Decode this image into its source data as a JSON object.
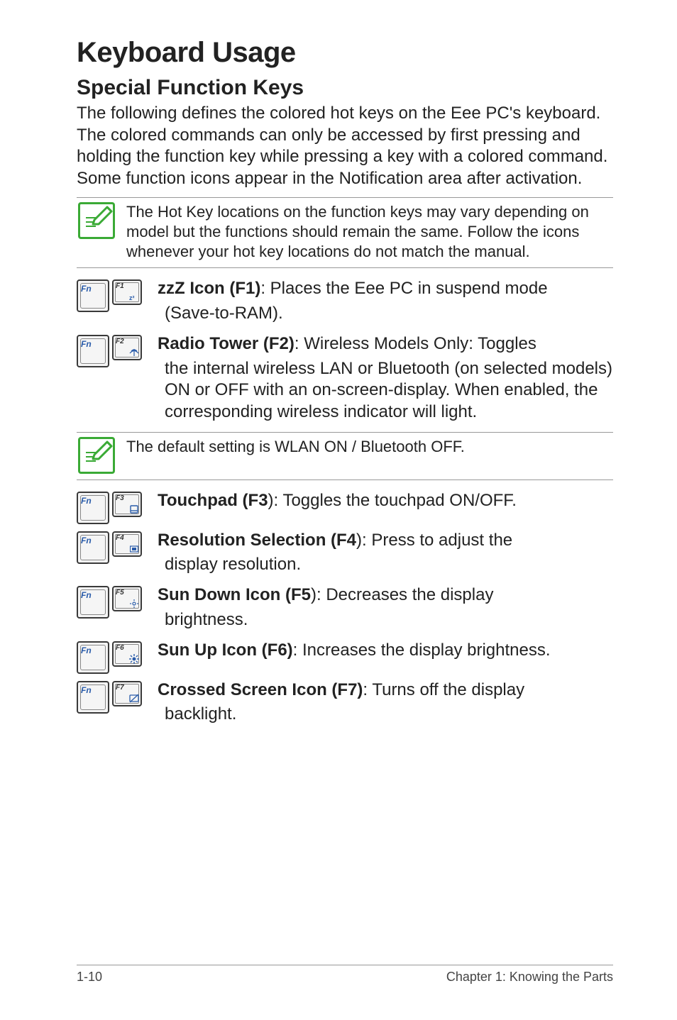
{
  "title": "Keyboard Usage",
  "subtitle": "Special Function Keys",
  "intro": "The following defines the colored hot keys on the Eee PC's keyboard. The colored commands can only be accessed by first pressing and holding the function key while pressing a key with a colored command. Some function icons appear in the Notification area after activation.",
  "note1": "The Hot Key locations on the function keys may vary depending on model but the functions should remain the same. Follow the icons whenever your hot key locations do not match the manual.",
  "items": {
    "f1": {
      "key": "F1",
      "bold": "zzZ Icon (F1)",
      "lead": ": Places the Eee PC in suspend mode",
      "sub": " (Save-to-RAM)."
    },
    "f2": {
      "key": "F2",
      "bold": "Radio Tower (F2)",
      "lead": ": Wireless Models Only: Toggles",
      "sub": "the internal wireless LAN or Bluetooth (on selected models) ON or OFF with an on-screen-display. When enabled, the corresponding wireless indicator will light."
    },
    "note2": "The default setting is WLAN ON / Bluetooth OFF.",
    "f3": {
      "key": "F3",
      "bold": "Touchpad (F3",
      "lead": "): Toggles the touchpad ON/OFF."
    },
    "f4": {
      "key": "F4",
      "bold": "Resolution Selection (F4",
      "lead": "): Press to adjust the",
      "sub": "display resolution."
    },
    "f5": {
      "key": "F5",
      "bold": "Sun Down Icon (F5",
      "lead": "): Decreases the display",
      "sub": "brightness."
    },
    "f6": {
      "key": "F6",
      "bold": "Sun Up Icon (F6)",
      "lead": ": Increases the display brightness."
    },
    "f7": {
      "key": "F7",
      "bold": "Crossed Screen Icon (F7)",
      "lead": ": Turns off the display",
      "sub": "backlight."
    }
  },
  "footer": {
    "left": "1-10",
    "right": "Chapter 1: Knowing the Parts"
  },
  "fnLabel": "Fn"
}
